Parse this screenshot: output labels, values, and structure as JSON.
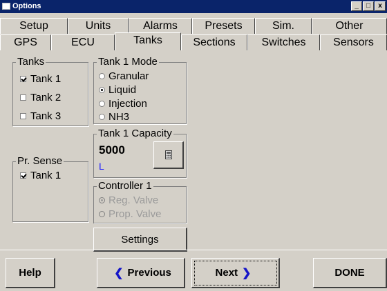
{
  "window": {
    "title": "Options",
    "controls": [
      "_",
      "□",
      "x"
    ]
  },
  "tabs": {
    "row1": [
      "Setup",
      "Units",
      "Alarms",
      "Presets",
      "Sim.",
      "Other"
    ],
    "row2": [
      "GPS",
      "ECU",
      "Tanks",
      "Sections",
      "Switches",
      "Sensors"
    ],
    "active": "Tanks"
  },
  "tanks_group": {
    "legend": "Tanks",
    "items": [
      {
        "label": "Tank 1",
        "checked": true
      },
      {
        "label": "Tank 2",
        "checked": false
      },
      {
        "label": "Tank 3",
        "checked": false
      }
    ]
  },
  "pr_sense_group": {
    "legend": "Pr. Sense",
    "items": [
      {
        "label": "Tank 1",
        "checked": true
      }
    ]
  },
  "mode_group": {
    "legend": "Tank 1 Mode",
    "options": [
      {
        "label": "Granular",
        "selected": false
      },
      {
        "label": "Liquid",
        "selected": true
      },
      {
        "label": "Injection",
        "selected": false
      },
      {
        "label": "NH3",
        "selected": false
      }
    ]
  },
  "capacity_group": {
    "legend": "Tank 1 Capacity",
    "value": "5000",
    "unit": "L",
    "calculator_icon": "calculator-icon"
  },
  "controller_group": {
    "legend": "Controller 1",
    "options": [
      {
        "label": "Reg. Valve",
        "selected": true
      },
      {
        "label": "Prop. Valve",
        "selected": false
      }
    ]
  },
  "buttons": {
    "settings": "Settings",
    "help": "Help",
    "previous": "Previous",
    "next": "Next",
    "done": "DONE"
  },
  "colors": {
    "titlebar": "#0a246a",
    "arrow": "#1515c8",
    "unit": "#1a1aff"
  }
}
